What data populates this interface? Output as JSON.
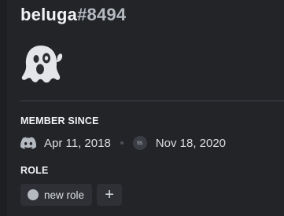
{
  "profile": {
    "username": "beluga",
    "discriminator": "#8494",
    "avatar_emoji": "ghost-icon"
  },
  "member_since": {
    "title": "MEMBER SINCE",
    "discord_date": "Apr 11, 2018",
    "server_icon_text": "tis",
    "server_date": "Nov 18, 2020"
  },
  "roles": {
    "title": "ROLE",
    "items": [
      {
        "label": "new role",
        "color": "#b5bac1"
      }
    ],
    "add_label": "+"
  },
  "colors": {
    "background": "#232428",
    "text_primary": "#f2f3f5",
    "text_secondary": "#b5bac1",
    "pill_background": "#2e3035"
  }
}
